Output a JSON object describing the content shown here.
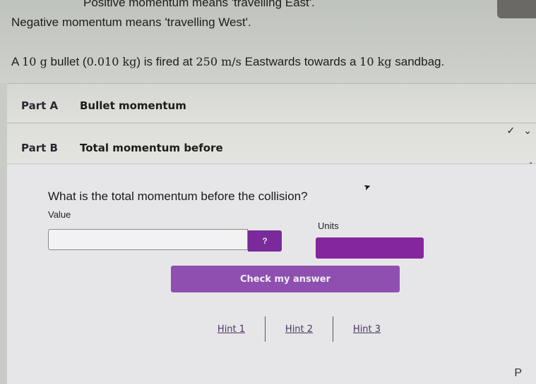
{
  "intro": {
    "line_east": "Positive momentum means 'travelling East'.",
    "line_west": "Negative momentum means 'travelling West'.",
    "bullet_prefix": "A ",
    "bullet_mass_g": "10 g",
    "bullet_mid": " bullet (",
    "bullet_mass_kg": "0.010 kg",
    "bullet_mid2": ") is fired at ",
    "bullet_speed": "250 m/s",
    "bullet_mid3": " Eastwards towards a ",
    "sandbag_mass": "10 kg",
    "bullet_suffix": " sandbag."
  },
  "parts": [
    {
      "label": "Part A",
      "title": "Bullet momentum",
      "status_icons": [
        "check-icon",
        "chevron-down-icon"
      ],
      "status_glyphs": [
        "✓",
        "⌄"
      ]
    },
    {
      "label": "Part B",
      "title": "Total momentum before",
      "expanded_icon": "chevron-up-icon",
      "expanded_glyph": "^"
    }
  ],
  "question": {
    "text": "What is the total momentum before the collision?",
    "value_label": "Value",
    "value_input": "",
    "value_placeholder": "",
    "help_button": "?",
    "units_label": "Units",
    "units_selected": "",
    "check_button": "Check my answer"
  },
  "hints": [
    "Hint 1",
    "Hint 2",
    "Hint 3"
  ],
  "footer": {
    "letter": "P"
  },
  "colors": {
    "accent_purple": "#84279f",
    "check_button": "#8e4fb0",
    "hint_link": "#4a3464"
  }
}
